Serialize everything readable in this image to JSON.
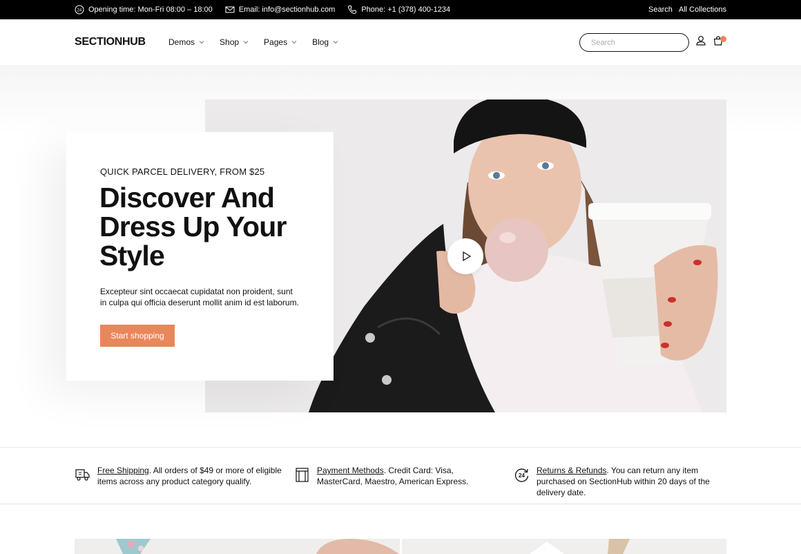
{
  "topbar": {
    "opening": "Opening time: Mon-Fri 08:00 – 18:00",
    "email": "Email: info@sectionhub.com",
    "phone": "Phone: +1 (378) 400-1234",
    "links": [
      "Search",
      "All Collections"
    ],
    "icons": [
      "clock-24-icon",
      "mail-icon",
      "phone-icon"
    ]
  },
  "header": {
    "logo": "SECTIONHUB",
    "nav": [
      {
        "label": "Demos"
      },
      {
        "label": "Shop"
      },
      {
        "label": "Pages"
      },
      {
        "label": "Blog"
      }
    ],
    "search_placeholder": "Search",
    "icons": [
      "user-icon",
      "cart-icon"
    ]
  },
  "hero": {
    "eyebrow": "QUICK PARCEL DELIVERY, FROM $25",
    "title": "Discover And Dress Up Your Style",
    "description": "Excepteur sint occaecat cupidatat non proident, sunt in culpa qui officia deserunt mollit anim id est laborum.",
    "cta": "Start shopping",
    "play_icon": "play-icon"
  },
  "features": [
    {
      "link": "Free Shipping",
      "text": ". All orders of $49 or more of eligible items across any product category qualify.",
      "icon": "truck-icon"
    },
    {
      "link": "Payment Methods",
      "text": ". Credit Card: Visa, MasterCard, Maestro, American Express.",
      "icon": "card-icon"
    },
    {
      "link": "Returns & Refunds",
      "text": ". You can return any item purchased on SectionHub within 20 days of the delivery date.",
      "icon": "return-24-icon"
    }
  ],
  "colors": {
    "accent": "#e8875b",
    "topbar": "#000000"
  }
}
